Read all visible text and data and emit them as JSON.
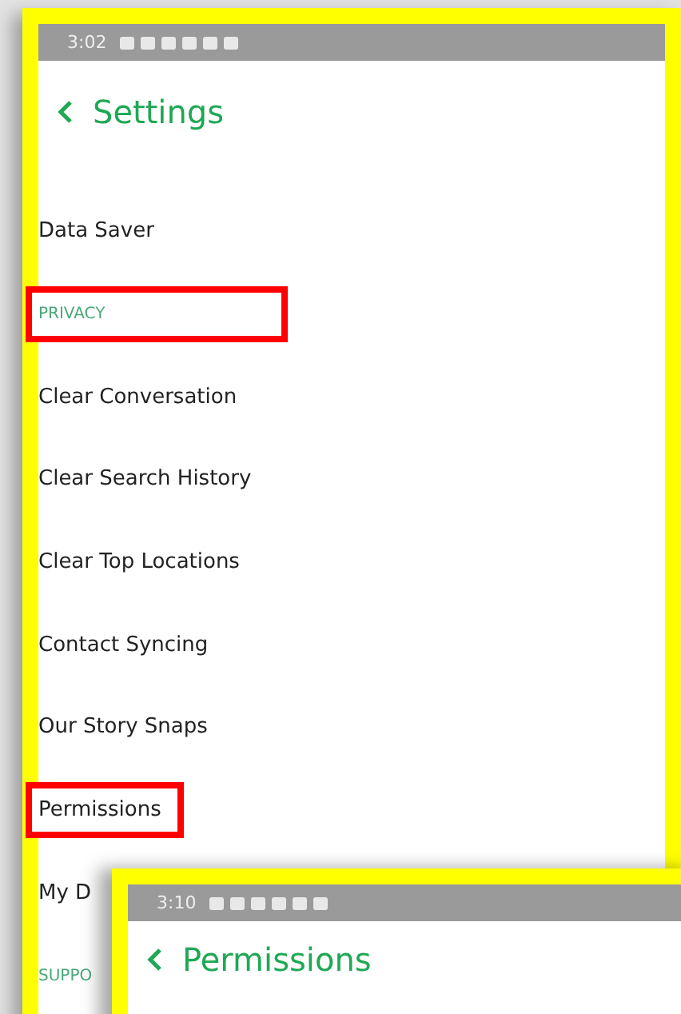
{
  "screens": [
    {
      "status_time": "3:02",
      "title": "Settings",
      "items": [
        {
          "kind": "row",
          "label": "Data Saver",
          "highlighted": false
        },
        {
          "kind": "section",
          "label": "PRIVACY",
          "highlighted": true
        },
        {
          "kind": "row",
          "label": "Clear Conversation",
          "highlighted": false
        },
        {
          "kind": "row",
          "label": "Clear Search History",
          "highlighted": false
        },
        {
          "kind": "row",
          "label": "Clear Top Locations",
          "highlighted": false
        },
        {
          "kind": "row",
          "label": "Contact Syncing",
          "highlighted": false
        },
        {
          "kind": "row",
          "label": "Our Story Snaps",
          "highlighted": false
        },
        {
          "kind": "row",
          "label": "Permissions",
          "highlighted": true
        },
        {
          "kind": "row",
          "label": "My D",
          "highlighted": false
        },
        {
          "kind": "section",
          "label": "SUPPO",
          "highlighted": false
        }
      ]
    },
    {
      "status_time": "3:10",
      "title": "Permissions"
    }
  ]
}
